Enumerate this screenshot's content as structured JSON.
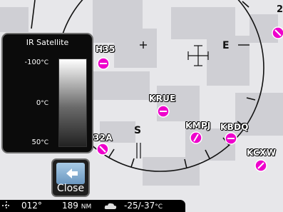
{
  "map": {
    "waypoints": [
      {
        "id": "wp-h35",
        "label": "H35"
      },
      {
        "id": "wp-krue",
        "label": "KRUE"
      },
      {
        "id": "wp-kmpj",
        "label": "KMPJ"
      },
      {
        "id": "wp-kbdq",
        "label": "KBDQ"
      },
      {
        "id": "wp-kcxw",
        "label": "KCXW"
      },
      {
        "id": "wp-32a",
        "label": "32A"
      }
    ],
    "cardinals": {
      "east": "E",
      "south": "S",
      "top_right": "2"
    },
    "colors": {
      "airport": "#ee00cc",
      "cloud": "#cfcfd4",
      "land": "#e7e7ea"
    }
  },
  "legend": {
    "title": "IR Satellite",
    "labels": [
      {
        "value": "-100",
        "unit": "°C"
      },
      {
        "value": "0",
        "unit": "°C"
      },
      {
        "value": "50",
        "unit": "°C"
      }
    ]
  },
  "close_button": {
    "label": "Close"
  },
  "status_bar": {
    "icon": "position-icon",
    "track": "012°",
    "distance": "189",
    "distance_unit": "NM",
    "weather_icon": "cloud-icon",
    "temps": "-25/-37",
    "temp_unit": "°C"
  }
}
